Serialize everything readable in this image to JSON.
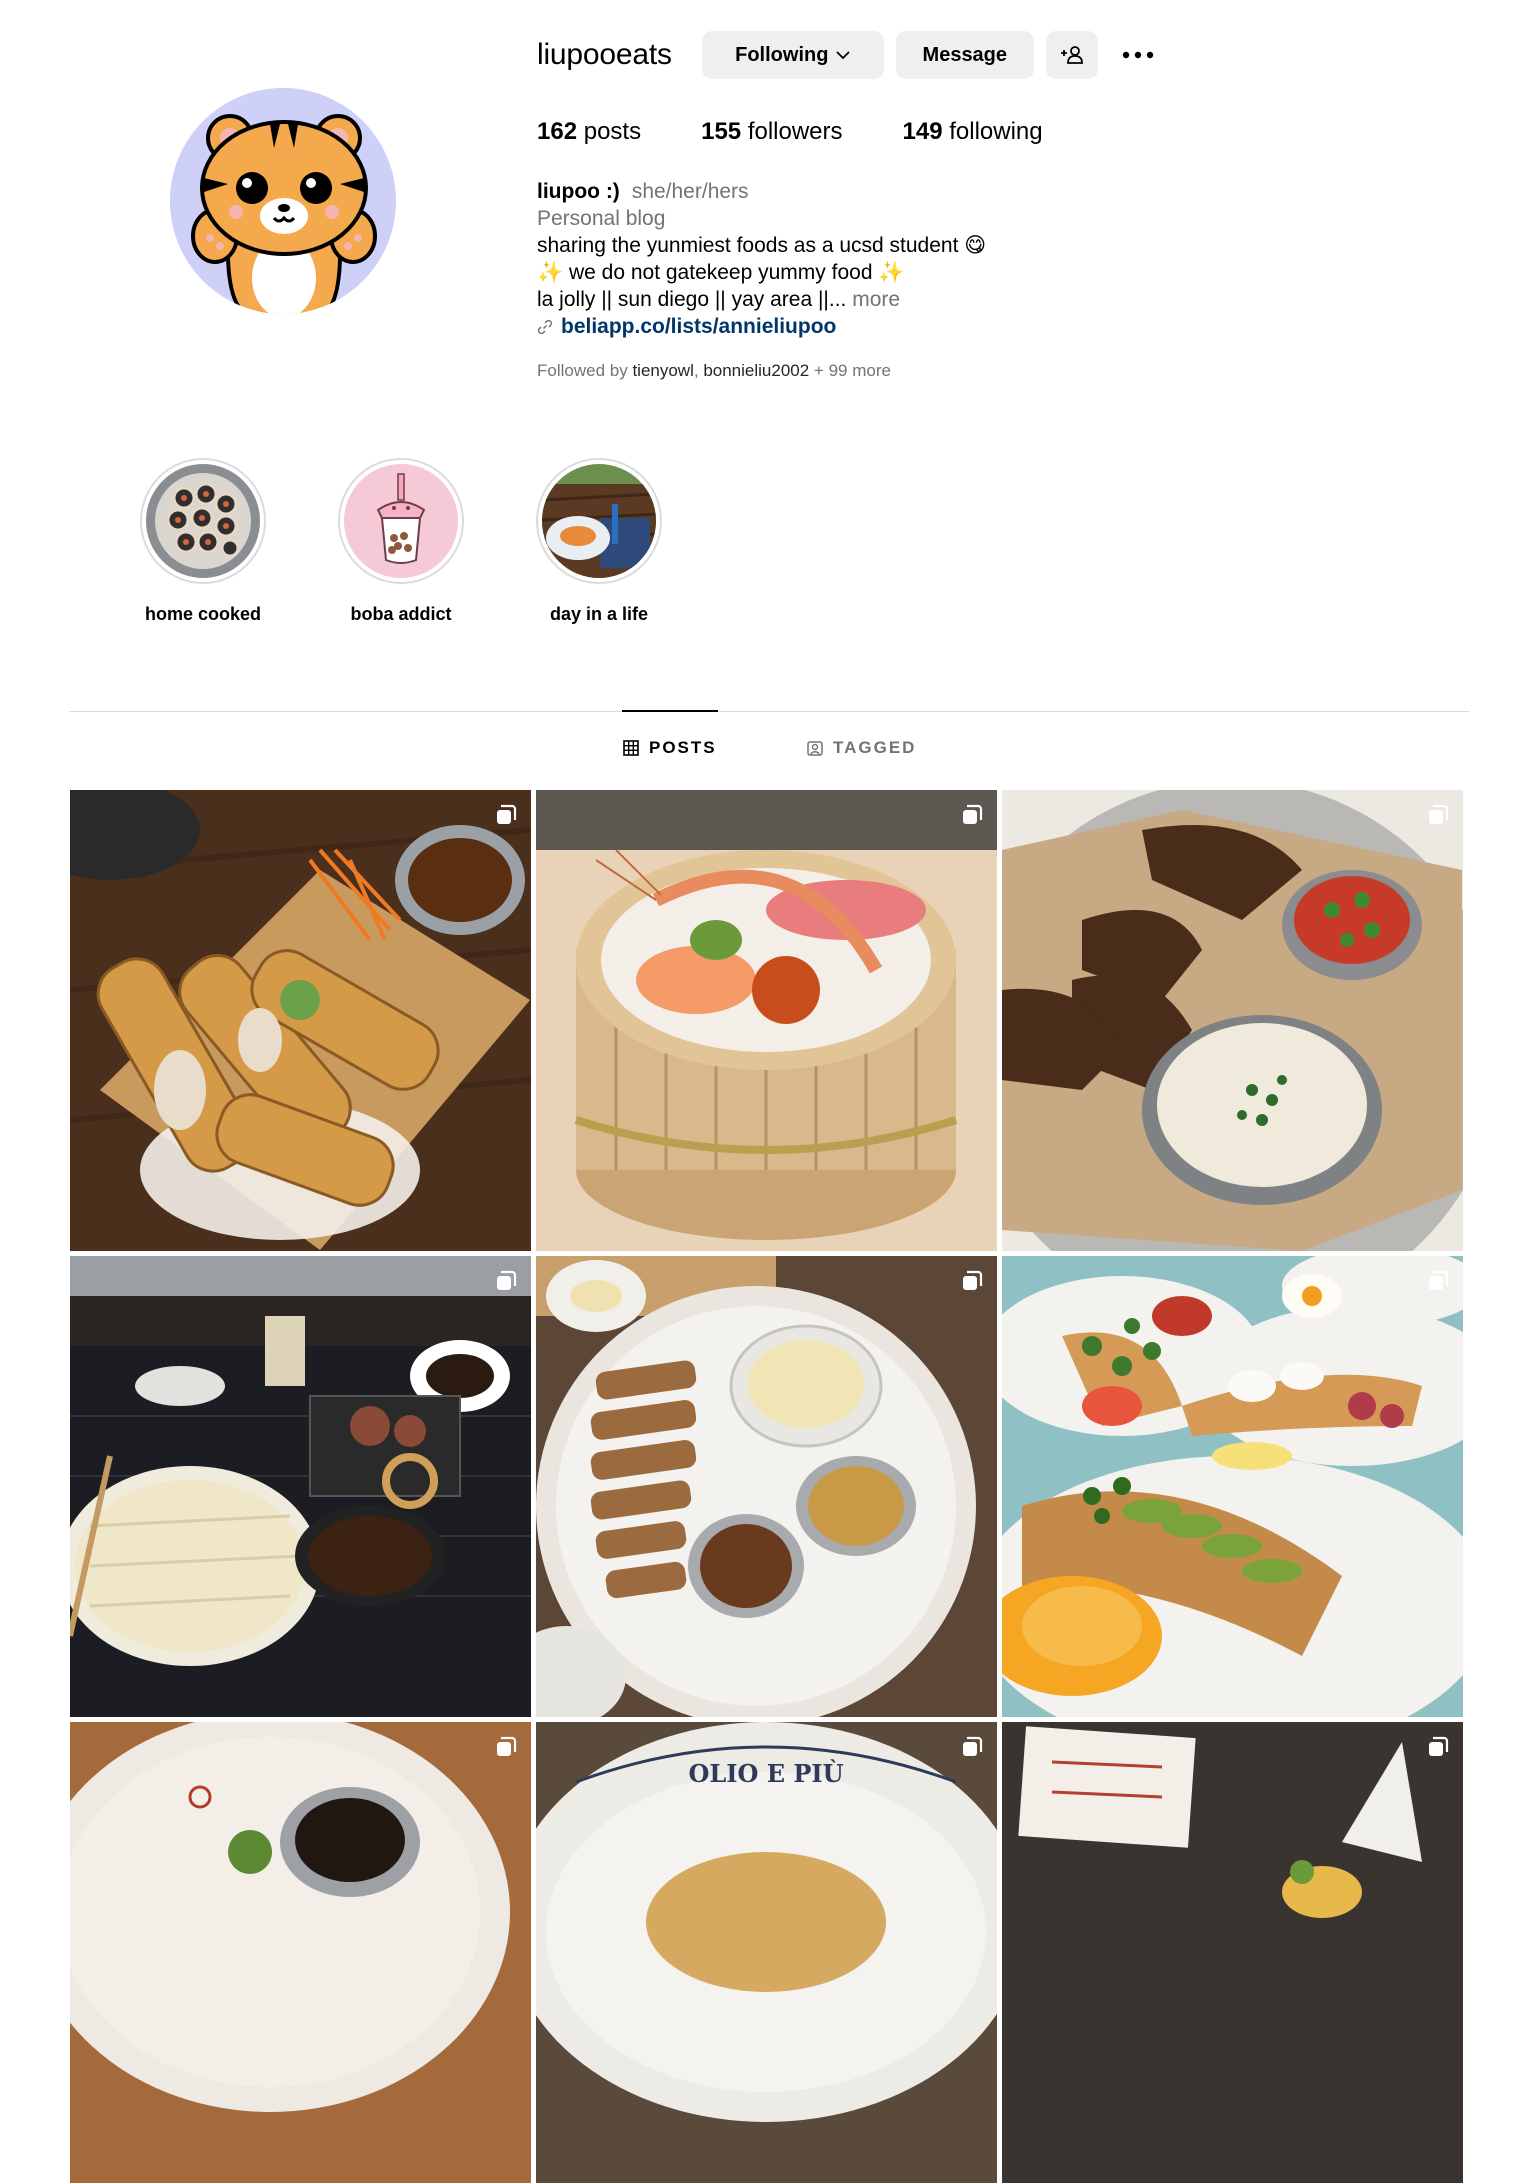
{
  "profile": {
    "username": "liupooeats",
    "following_label": "Following",
    "message_label": "Message",
    "stats": {
      "posts_count": "162",
      "posts_label": "posts",
      "followers_count": "155",
      "followers_label": "followers",
      "following_count": "149",
      "following_label": "following"
    },
    "bio": {
      "name": "liupoo :)",
      "pronouns": "she/her/hers",
      "category": "Personal blog",
      "line1": "sharing the yunmiest foods as a ucsd student 😋",
      "line2": "✨ we do not gatekeep yummy food ✨",
      "line3": "la jolly || sun diego || yay area ||...",
      "more": " more",
      "link": "beliapp.co/lists/annieliupoo"
    },
    "followed_by": {
      "prefix": "Followed by ",
      "user1": "tienyowl",
      "sep": ", ",
      "user2": "bonnieliu2002",
      "suffix": " + 99 more"
    }
  },
  "highlights": [
    {
      "label": "home cooked"
    },
    {
      "label": "boba addict"
    },
    {
      "label": "day in a life"
    }
  ],
  "tabs": {
    "posts": "POSTS",
    "tagged": "TAGGED"
  },
  "colors": {
    "button_bg": "#efefef",
    "secondary_text": "#737373",
    "link": "#00376b",
    "avatar_bg": "#cfd0f7"
  }
}
